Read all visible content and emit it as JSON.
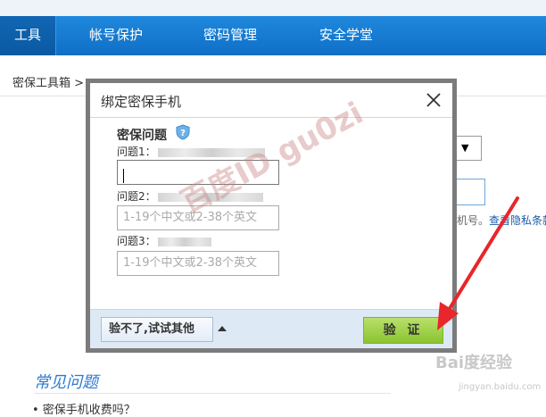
{
  "nav": {
    "items": [
      {
        "label": "工具"
      },
      {
        "label": "帐号保护"
      },
      {
        "label": "密码管理"
      },
      {
        "label": "安全学堂"
      }
    ]
  },
  "breadcrumb": {
    "text": "密保工具箱 >"
  },
  "background": {
    "side_text_prefix": "机号。",
    "side_link": "查看隐私条款"
  },
  "faq": {
    "title": "常见问题",
    "item": "• 密保手机收费吗？"
  },
  "modal": {
    "title": "绑定密保手机",
    "section_title": "密保问题",
    "questions": [
      {
        "label": "问题1：",
        "value": "",
        "placeholder": ""
      },
      {
        "label": "问题2：",
        "value": "",
        "placeholder": "1-19个中文或2-38个英文"
      },
      {
        "label": "问题3：",
        "value": "",
        "placeholder": "1-19个中文或2-38个英文"
      }
    ],
    "alt_button": "验不了,试试其他",
    "verify_button": "验 证",
    "watermark": "百度ID gu0zi"
  },
  "watermark": {
    "logo": "Bai度经验",
    "sub": "jingyan.baidu.com"
  },
  "colors": {
    "nav": "#1a7fd4",
    "verify": "#9fd04a",
    "arrow": "#e8262b",
    "faq_title": "#2b7ad0"
  }
}
